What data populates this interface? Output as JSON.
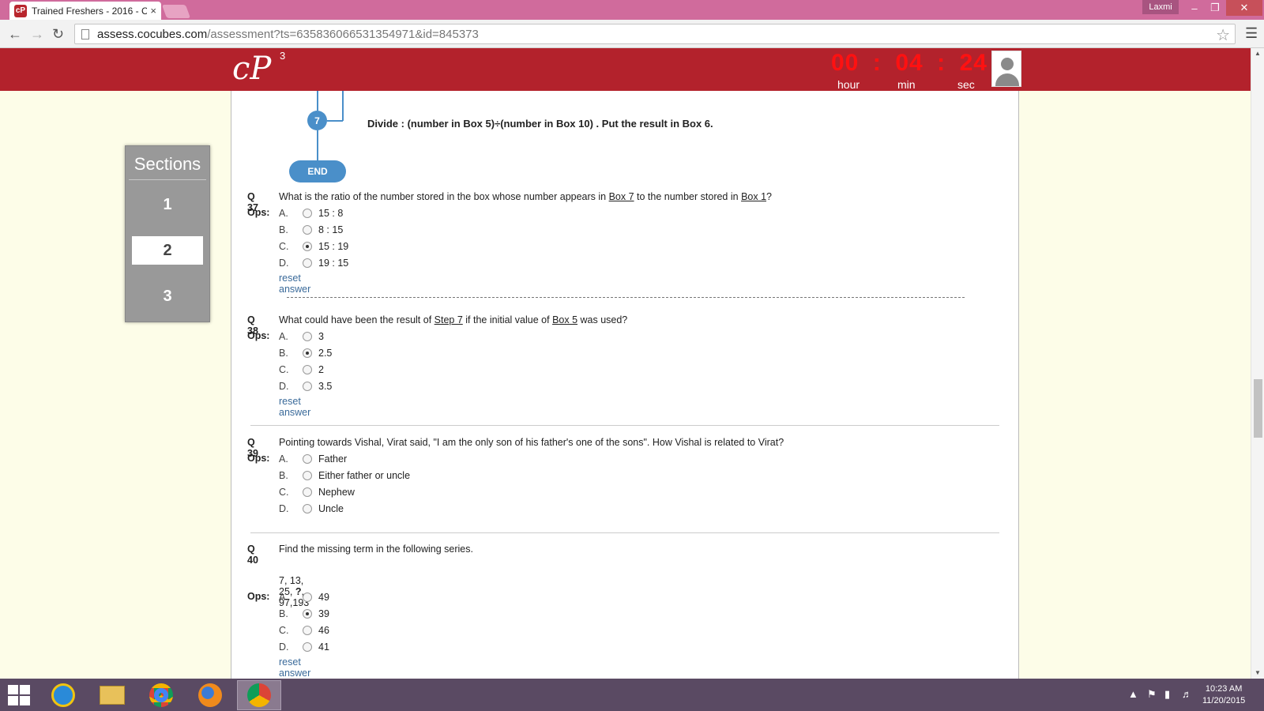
{
  "browser": {
    "tab_title": "Trained Freshers - 2016 - C",
    "tab_close": "×",
    "user_name": "Laxmi",
    "url_host": "assess.cocubes.com",
    "url_path": "/assessment?ts=635836066531354971&id=845373"
  },
  "header": {
    "logo_text": "cP",
    "logo_sup": "3",
    "timer": {
      "hours": "00",
      "minutes": "04",
      "seconds": "24",
      "sep": ":",
      "hour_label": "hour",
      "min_label": "min",
      "sec_label": "sec",
      "color": "#ff1111"
    },
    "brand_color": "#b3222c"
  },
  "sections": {
    "title": "Sections",
    "items": [
      "1",
      "2",
      "3"
    ],
    "active": "2"
  },
  "flow": {
    "node": "7",
    "end": "END",
    "step_text": "Divide : (number in Box 5)÷(number in Box 10) . Put the result in Box 6."
  },
  "ops_label": "Ops:",
  "reset_label": "reset answer",
  "questions": [
    {
      "num": "Q 37",
      "text_parts": [
        "What is the ratio of the number stored in the box whose number appears in ",
        "Box 7",
        " to the number stored in ",
        "Box 1",
        "?"
      ],
      "options": [
        {
          "letter": "A.",
          "text": "15 : 8",
          "checked": false
        },
        {
          "letter": "B.",
          "text": "8 : 15",
          "checked": false
        },
        {
          "letter": "C.",
          "text": "15 : 19",
          "checked": true
        },
        {
          "letter": "D.",
          "text": "19 : 15",
          "checked": false
        }
      ]
    },
    {
      "num": "Q 38",
      "text_parts": [
        "What could have been the result of ",
        "Step 7",
        " if the initial value of ",
        "Box 5",
        " was used?"
      ],
      "options": [
        {
          "letter": "A.",
          "text": "3",
          "checked": false
        },
        {
          "letter": "B.",
          "text": "2.5",
          "checked": true
        },
        {
          "letter": "C.",
          "text": "2",
          "checked": false
        },
        {
          "letter": "D.",
          "text": "3.5",
          "checked": false
        }
      ]
    },
    {
      "num": "Q 39",
      "text": "Pointing towards Vishal, Virat said, \"I am the only son of his father's one of the sons\". How Vishal is related to Virat?",
      "options": [
        {
          "letter": "A.",
          "text": "Father",
          "checked": false
        },
        {
          "letter": "B.",
          "text": "Either father or uncle",
          "checked": false
        },
        {
          "letter": "C.",
          "text": "Nephew",
          "checked": false
        },
        {
          "letter": "D.",
          "text": "Uncle",
          "checked": false
        }
      ]
    },
    {
      "num": "Q 40",
      "text": "Find the missing term in the following series.",
      "series_prefix": "7, 13, 25, ",
      "series_mark": "?",
      "series_suffix": ", 97,193",
      "options": [
        {
          "letter": "A.",
          "text": "49",
          "checked": false
        },
        {
          "letter": "B.",
          "text": "39",
          "checked": true
        },
        {
          "letter": "C.",
          "text": "46",
          "checked": false
        },
        {
          "letter": "D.",
          "text": "41",
          "checked": false
        }
      ]
    }
  ],
  "taskbar": {
    "time": "10:23 AM",
    "date": "11/20/2015"
  }
}
